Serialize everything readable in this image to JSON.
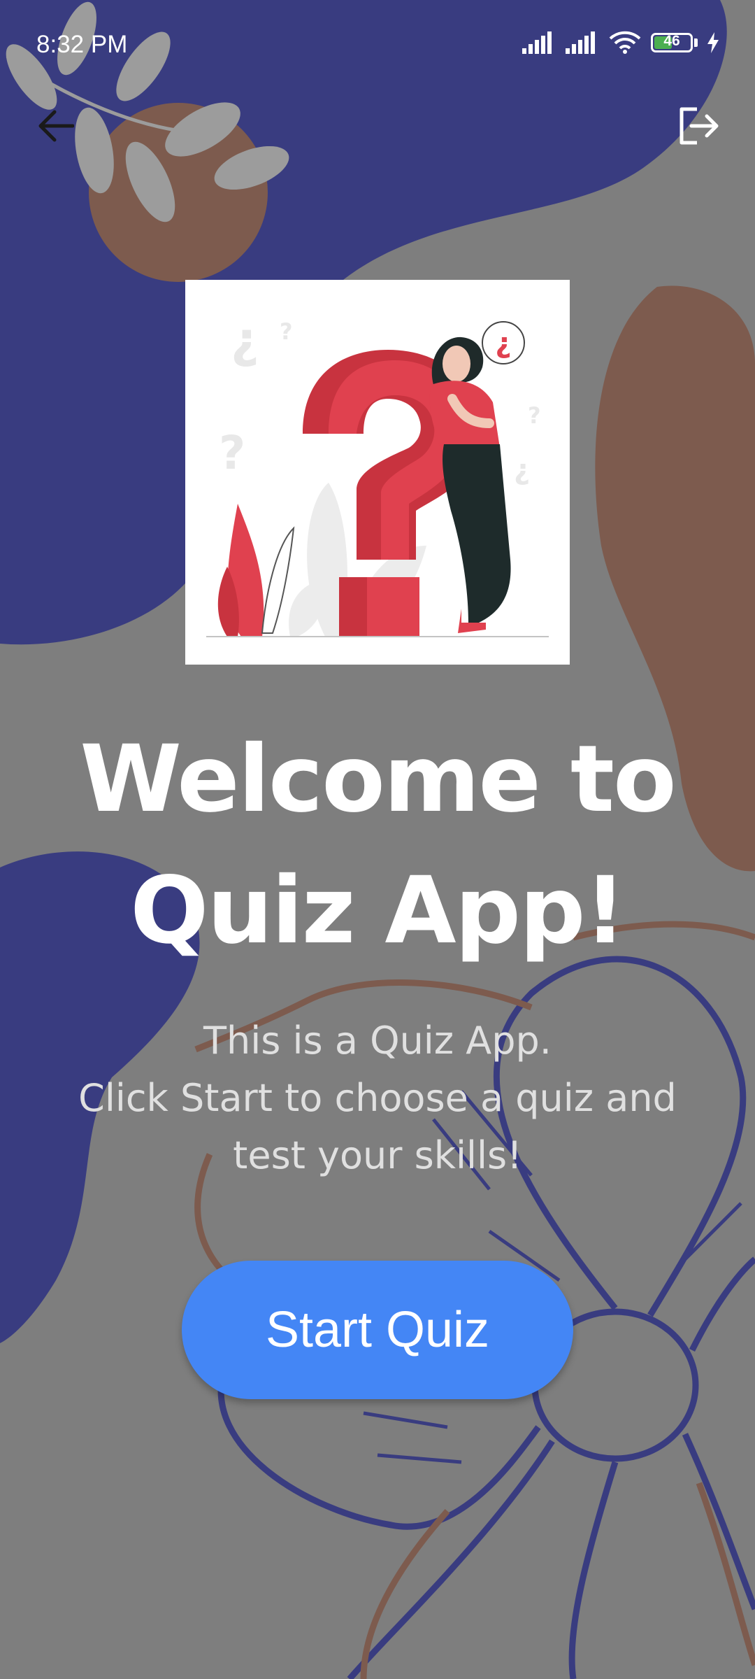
{
  "status_bar": {
    "time": "8:32 PM",
    "battery_level": "46",
    "battery_fraction": 0.46
  },
  "header": {
    "back_icon": "arrow-left-icon",
    "logout_icon": "logout-icon"
  },
  "hero": {
    "illustration": "thinking-person-question-mark-illustration",
    "speech_bubble_glyph": "¿"
  },
  "welcome": {
    "title_line1": "Welcome to",
    "title_line2": "Quiz App!"
  },
  "description": {
    "line1": "This is a Quiz App.",
    "line2": "Click Start to choose a quiz and",
    "line3": "test your skills!"
  },
  "start_button": {
    "label": "Start Quiz"
  },
  "colors": {
    "background": "#7e7e7e",
    "navy_blob": "#393c80",
    "brown_blob": "#7d5b4e",
    "button": "#4486f5",
    "accent_red": "#e0414f",
    "battery_green": "#4caf50"
  }
}
